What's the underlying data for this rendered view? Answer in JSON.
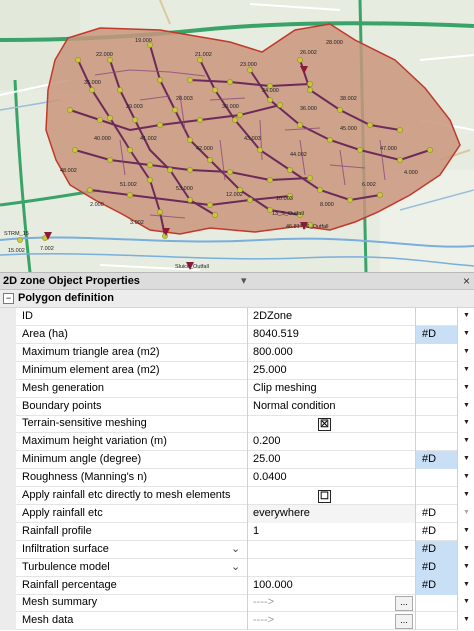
{
  "map": {
    "labels": [
      "STRM_15",
      "13_S_Outfall",
      "46.817_S_Outfall",
      "15.002",
      "7.002",
      "Sluice_Outfall",
      "22.000",
      "19.000",
      "21.002",
      "23.000",
      "26.002",
      "28.000",
      "35.000",
      "29.003",
      "20.003",
      "30.000",
      "34.000",
      "36.000",
      "38.002",
      "40.000",
      "41.002",
      "42.000",
      "43.003",
      "44.002",
      "45.000",
      "47.000",
      "48.002",
      "51.002",
      "53.000",
      "12.002",
      "10.003",
      "8.000",
      "6.002",
      "4.000",
      "3.002",
      "2.000"
    ],
    "colors": {
      "zone_fill": "#c9957c",
      "zone_stroke": "#c0392b",
      "pipe": "#6b2a5a",
      "node": "#c8c83c"
    }
  },
  "panel": {
    "title": "2D zone Object Properties",
    "pin_icon": "▾",
    "close_label": "×",
    "section_toggle": "−",
    "section_label": "Polygon definition",
    "rows": [
      {
        "name": "ID",
        "value": "2DZone",
        "unit": "",
        "unit_hl": false,
        "dd": true,
        "dd_dis": false
      },
      {
        "name": "Area (ha)",
        "value": "8040.519",
        "unit": "#D",
        "unit_hl": true,
        "dd": true,
        "dd_dis": false
      },
      {
        "name": "Maximum triangle area (m2)",
        "value": "800.000",
        "unit": "",
        "unit_hl": false,
        "dd": true,
        "dd_dis": false
      },
      {
        "name": "Minimum element area (m2)",
        "value": "25.000",
        "unit": "",
        "unit_hl": false,
        "dd": true,
        "dd_dis": false
      },
      {
        "name": "Mesh generation",
        "value": "Clip meshing",
        "unit": "",
        "unit_hl": false,
        "dd": true,
        "dd_dis": false
      },
      {
        "name": "Boundary points",
        "value": "Normal condition",
        "unit": "",
        "unit_hl": false,
        "dd": true,
        "dd_dis": false
      },
      {
        "name": "Terrain-sensitive meshing",
        "value": "",
        "check": "☒",
        "unit": "",
        "unit_hl": false,
        "dd": true,
        "dd_dis": false
      },
      {
        "name": "Maximum height variation (m)",
        "value": "0.200",
        "unit": "",
        "unit_hl": false,
        "dd": true,
        "dd_dis": false
      },
      {
        "name": "Minimum angle (degree)",
        "value": "25.00",
        "unit": "#D",
        "unit_hl": true,
        "dd": true,
        "dd_dis": false
      },
      {
        "name": "Roughness (Manning's n)",
        "value": "0.0400",
        "unit": "",
        "unit_hl": false,
        "dd": true,
        "dd_dis": false
      },
      {
        "name": "Apply rainfall etc directly to mesh elements",
        "value": "",
        "check": "☐",
        "unit": "",
        "unit_hl": false,
        "dd": true,
        "dd_dis": false
      },
      {
        "name": "Apply rainfall etc",
        "value": "everywhere",
        "unit": "#D",
        "unit_hl": false,
        "dd": true,
        "dd_dis": true,
        "greyrow": true
      },
      {
        "name": "Rainfall profile",
        "value": "1",
        "unit": "#D",
        "unit_hl": false,
        "dd": true,
        "dd_dis": false
      },
      {
        "name": "Infiltration surface",
        "value": "",
        "unit": "#D",
        "unit_hl": true,
        "dd": true,
        "dd_dis": false,
        "chev": "⌄"
      },
      {
        "name": "Turbulence model",
        "value": "",
        "unit": "#D",
        "unit_hl": true,
        "dd": true,
        "dd_dis": false,
        "chev": "⌄"
      },
      {
        "name": "Rainfall percentage",
        "value": "100.000",
        "unit": "#D",
        "unit_hl": true,
        "dd": true,
        "dd_dis": false
      },
      {
        "name": "Mesh summary",
        "value": "---->",
        "grey": true,
        "ellipsis": "...",
        "unit": "",
        "unit_hl": false,
        "dd": true,
        "dd_dis": false
      },
      {
        "name": "Mesh data",
        "value": "---->",
        "grey": true,
        "ellipsis": "...",
        "unit": "",
        "unit_hl": false,
        "dd": true,
        "dd_dis": false
      }
    ]
  }
}
